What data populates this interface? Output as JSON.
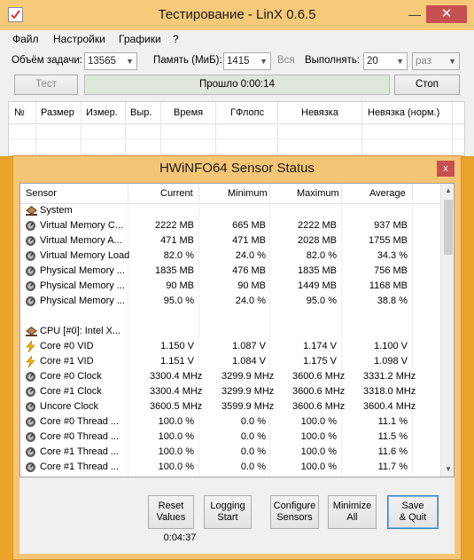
{
  "linx": {
    "title": "Тестирование - LinX 0.6.5",
    "window_min": "—",
    "window_close": "✕",
    "menu": [
      "Файл",
      "Настройки",
      "Графики",
      "?"
    ],
    "problem_size_label": "Объём задачи:",
    "problem_size_value": "13565",
    "memory_label": "Память (МиБ):",
    "memory_value": "1415",
    "memory_all": "Вся",
    "run_label": "Выполнять:",
    "run_value": "20",
    "run_unit": "раз",
    "test_button": "Тест",
    "progress_text": "Прошло 0:00:14",
    "stop_button": "Стоп",
    "columns": [
      "№",
      "Размер",
      "Измер.",
      "Выр.",
      "Время",
      "ГФлопс",
      "Невязка",
      "Невязка (норм.)"
    ]
  },
  "hwinfo": {
    "title": "HWiNFO64 Sensor Status",
    "close_icon": "x",
    "columns": [
      "Sensor",
      "Current",
      "Minimum",
      "Maximum",
      "Average"
    ],
    "rows": [
      {
        "name": "System",
        "icon": "chip-group-icon",
        "current": "",
        "min": "",
        "max": "",
        "avg": ""
      },
      {
        "name": "Virtual Memory C...",
        "icon": "sensor-icon",
        "current": "2222 MB",
        "min": "665 MB",
        "max": "2222 MB",
        "avg": "937 MB"
      },
      {
        "name": "Virtual Memory A...",
        "icon": "sensor-icon",
        "current": "471 MB",
        "min": "471 MB",
        "max": "2028 MB",
        "avg": "1755 MB"
      },
      {
        "name": "Virtual Memory Load",
        "icon": "sensor-icon",
        "current": "82.0 %",
        "min": "24.0 %",
        "max": "82.0 %",
        "avg": "34.3 %"
      },
      {
        "name": "Physical Memory ...",
        "icon": "sensor-icon",
        "current": "1835 MB",
        "min": "476 MB",
        "max": "1835 MB",
        "avg": "756 MB"
      },
      {
        "name": "Physical Memory ...",
        "icon": "sensor-icon",
        "current": "90 MB",
        "min": "90 MB",
        "max": "1449 MB",
        "avg": "1168 MB"
      },
      {
        "name": "Physical Memory ...",
        "icon": "sensor-icon",
        "current": "95.0 %",
        "min": "24.0 %",
        "max": "95.0 %",
        "avg": "38.8 %"
      },
      {
        "name": "",
        "icon": "",
        "current": "",
        "min": "",
        "max": "",
        "avg": ""
      },
      {
        "name": "CPU [#0]: Intel X...",
        "icon": "chip-group-icon",
        "current": "",
        "min": "",
        "max": "",
        "avg": ""
      },
      {
        "name": "Core #0 VID",
        "icon": "voltage-icon",
        "current": "1.150 V",
        "min": "1.087 V",
        "max": "1.174 V",
        "avg": "1.100 V"
      },
      {
        "name": "Core #1 VID",
        "icon": "voltage-icon",
        "current": "1.151 V",
        "min": "1.084 V",
        "max": "1.175 V",
        "avg": "1.098 V"
      },
      {
        "name": "Core #0 Clock",
        "icon": "sensor-icon",
        "current": "3300.4 MHz",
        "min": "3299.9 MHz",
        "max": "3600.6 MHz",
        "avg": "3331.2 MHz"
      },
      {
        "name": "Core #1 Clock",
        "icon": "sensor-icon",
        "current": "3300.4 MHz",
        "min": "3299.9 MHz",
        "max": "3600.6 MHz",
        "avg": "3318.0 MHz"
      },
      {
        "name": "Uncore Clock",
        "icon": "sensor-icon",
        "current": "3600.5 MHz",
        "min": "3599.9 MHz",
        "max": "3600.6 MHz",
        "avg": "3600.4 MHz"
      },
      {
        "name": "Core #0 Thread ...",
        "icon": "sensor-icon",
        "current": "100.0 %",
        "min": "0.0 %",
        "max": "100.0 %",
        "avg": "11.1 %"
      },
      {
        "name": "Core #0 Thread ...",
        "icon": "sensor-icon",
        "current": "100.0 %",
        "min": "0.0 %",
        "max": "100.0 %",
        "avg": "11.5 %"
      },
      {
        "name": "Core #1 Thread ...",
        "icon": "sensor-icon",
        "current": "100.0 %",
        "min": "0.0 %",
        "max": "100.0 %",
        "avg": "11.6 %"
      },
      {
        "name": "Core #1 Thread ...",
        "icon": "sensor-icon",
        "current": "100.0 %",
        "min": "0.0 %",
        "max": "100.0 %",
        "avg": "11.7 %"
      }
    ],
    "buttons": {
      "reset": [
        "Reset",
        "Values"
      ],
      "logging": [
        "Logging",
        "Start"
      ],
      "configure": [
        "Configure",
        "Sensors"
      ],
      "minimize": [
        "Minimize",
        "All"
      ],
      "save": [
        "Save",
        "& Quit"
      ]
    },
    "timer": "0:04:37"
  }
}
